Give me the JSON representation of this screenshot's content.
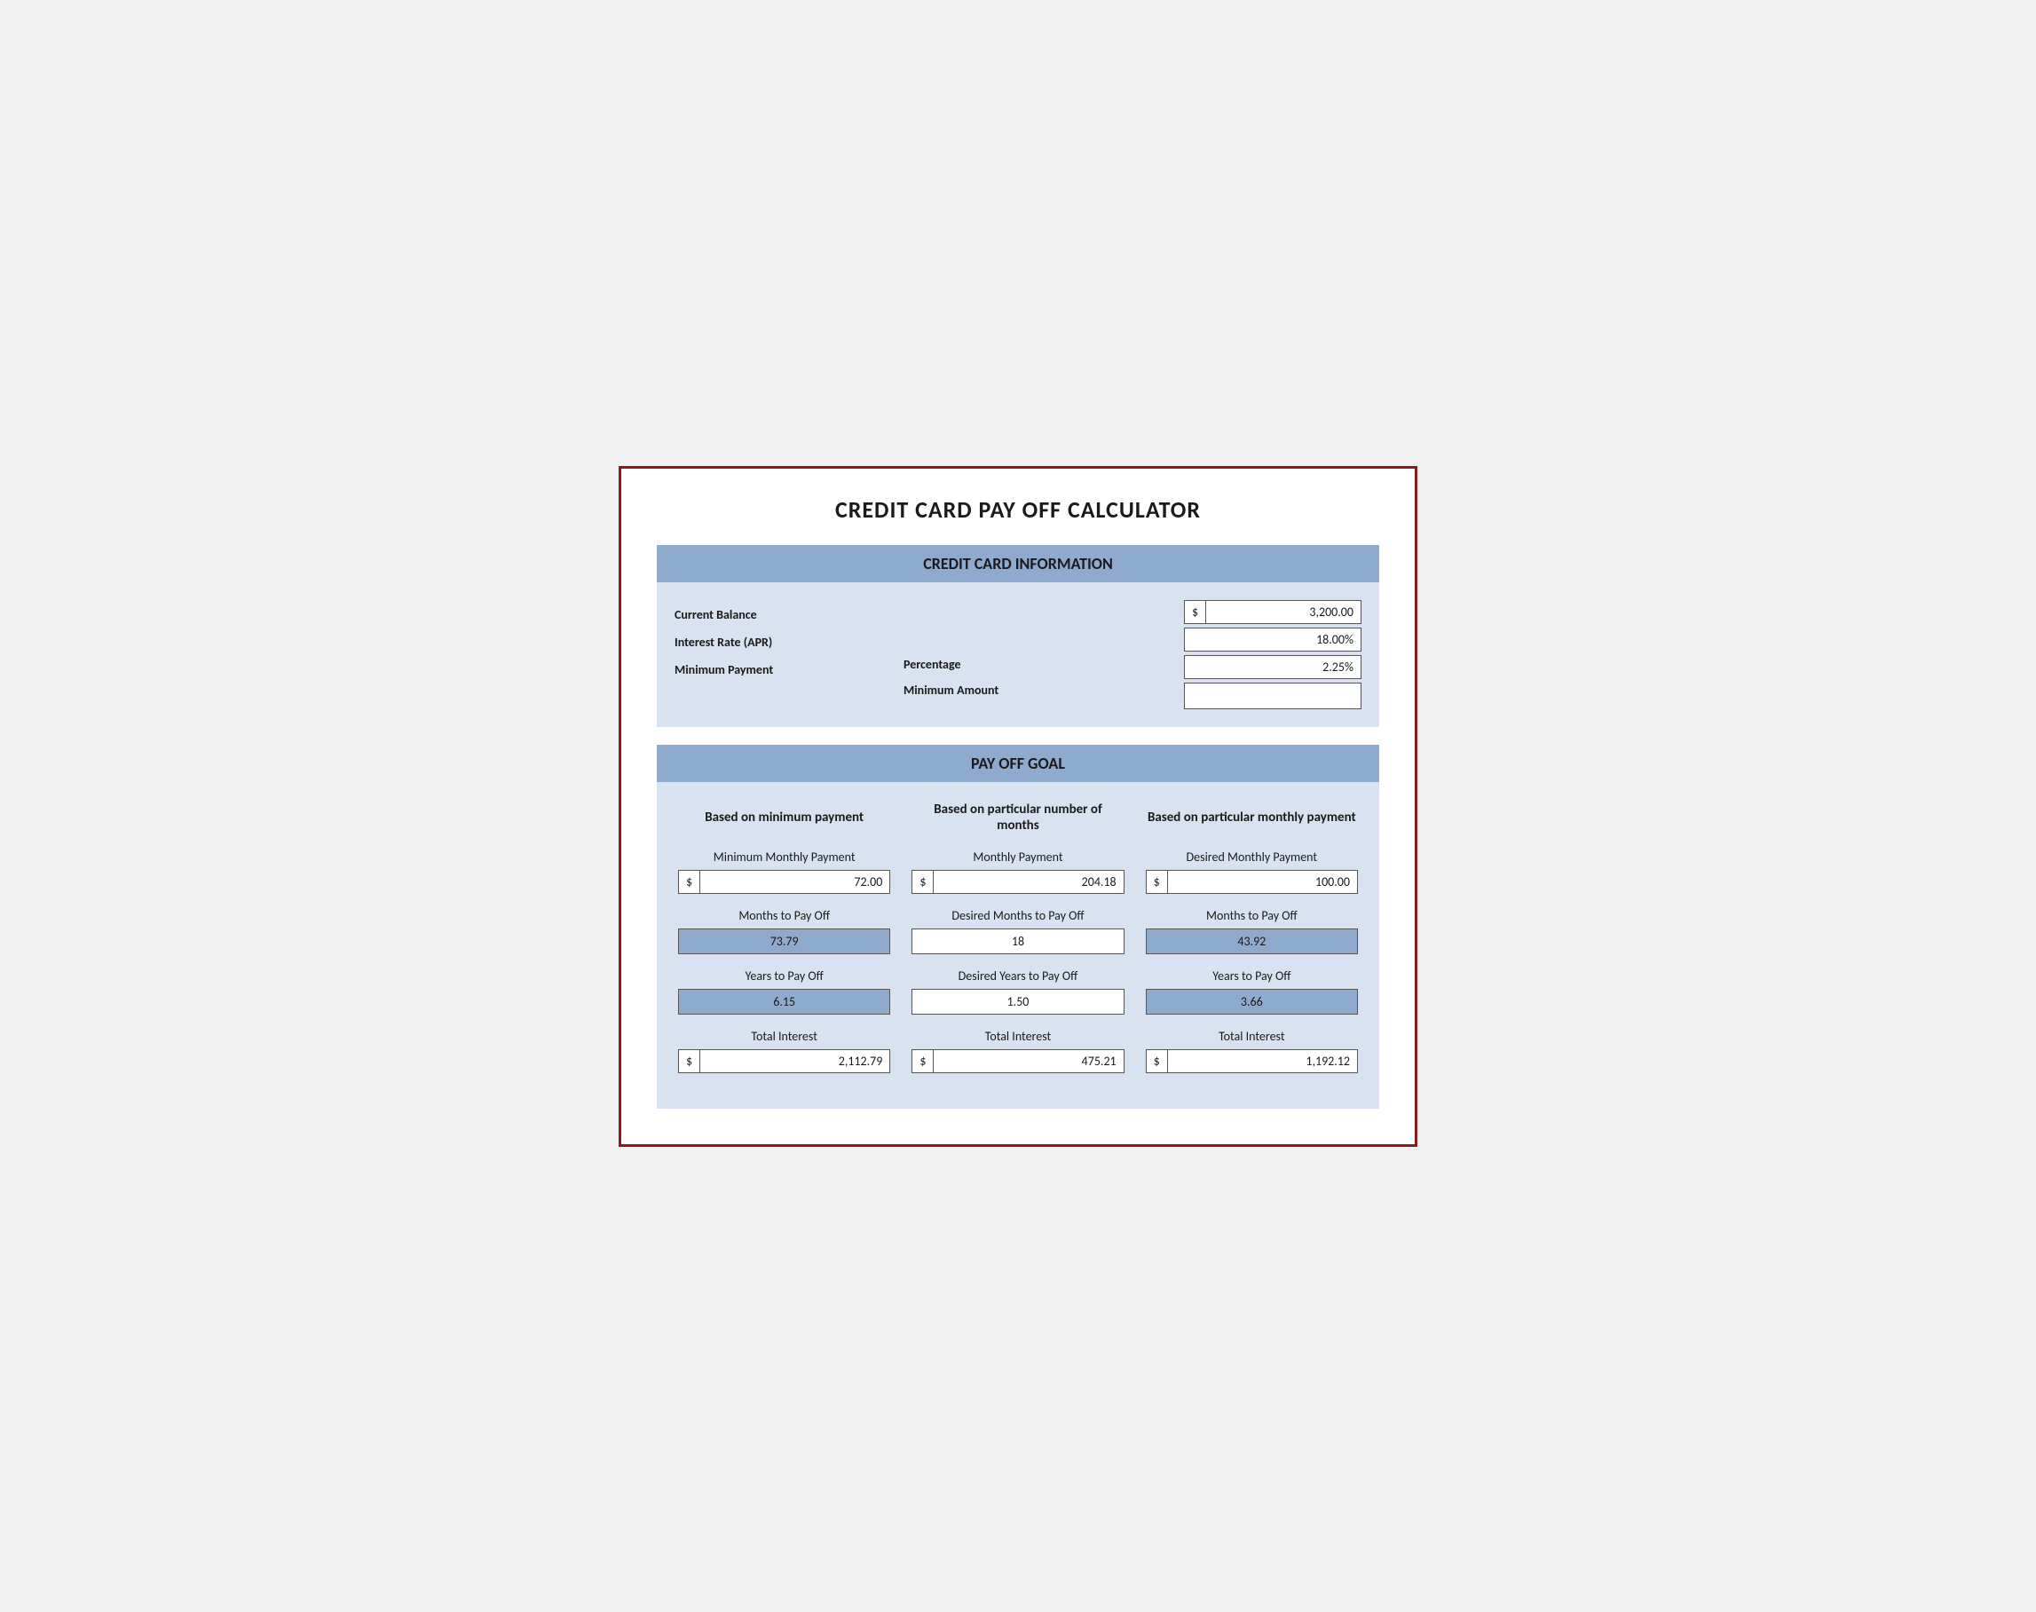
{
  "title": "CREDIT CARD PAY OFF CALCULATOR",
  "sections": {
    "info_header": "CREDIT CARD INFORMATION",
    "payoff_header": "PAY OFF GOAL"
  },
  "credit_card_info": {
    "labels": {
      "current_balance": "Current Balance",
      "interest_rate": "Interest Rate (APR)",
      "minimum_payment": "Minimum Payment"
    },
    "middle_labels": {
      "percentage": "Percentage",
      "minimum_amount": "Minimum Amount"
    },
    "values": {
      "current_balance_symbol": "$",
      "current_balance_amount": "3,200.00",
      "interest_rate": "18.00%",
      "min_payment_pct": "2.25%"
    }
  },
  "payoff_goal": {
    "columns": [
      {
        "title": "Based on minimum payment",
        "fields": [
          {
            "label": "Minimum Monthly Payment",
            "type": "currency_input",
            "symbol": "$",
            "value": "72.00"
          },
          {
            "label": "Months to Pay Off",
            "type": "result",
            "value": "73.79",
            "bg": "blue"
          },
          {
            "label": "Years to Pay Off",
            "type": "result",
            "value": "6.15",
            "bg": "blue"
          },
          {
            "label": "Total Interest",
            "type": "currency_result",
            "symbol": "$",
            "value": "2,112.79"
          }
        ]
      },
      {
        "title": "Based on particular number of months",
        "fields": [
          {
            "label": "Monthly Payment",
            "type": "currency_input",
            "symbol": "$",
            "value": "204.18"
          },
          {
            "label": "Desired Months to Pay Off",
            "type": "result",
            "value": "18",
            "bg": "white"
          },
          {
            "label": "Desired Years to Pay Off",
            "type": "result",
            "value": "1.50",
            "bg": "white"
          },
          {
            "label": "Total Interest",
            "type": "currency_result",
            "symbol": "$",
            "value": "475.21"
          }
        ]
      },
      {
        "title": "Based on particular monthly payment",
        "fields": [
          {
            "label": "Desired Monthly Payment",
            "type": "currency_input",
            "symbol": "$",
            "value": "100.00"
          },
          {
            "label": "Months to Pay Off",
            "type": "result",
            "value": "43.92",
            "bg": "blue"
          },
          {
            "label": "Years to Pay Off",
            "type": "result",
            "value": "3.66",
            "bg": "blue"
          },
          {
            "label": "Total Interest",
            "type": "currency_result",
            "symbol": "$",
            "value": "1,192.12"
          }
        ]
      }
    ]
  }
}
